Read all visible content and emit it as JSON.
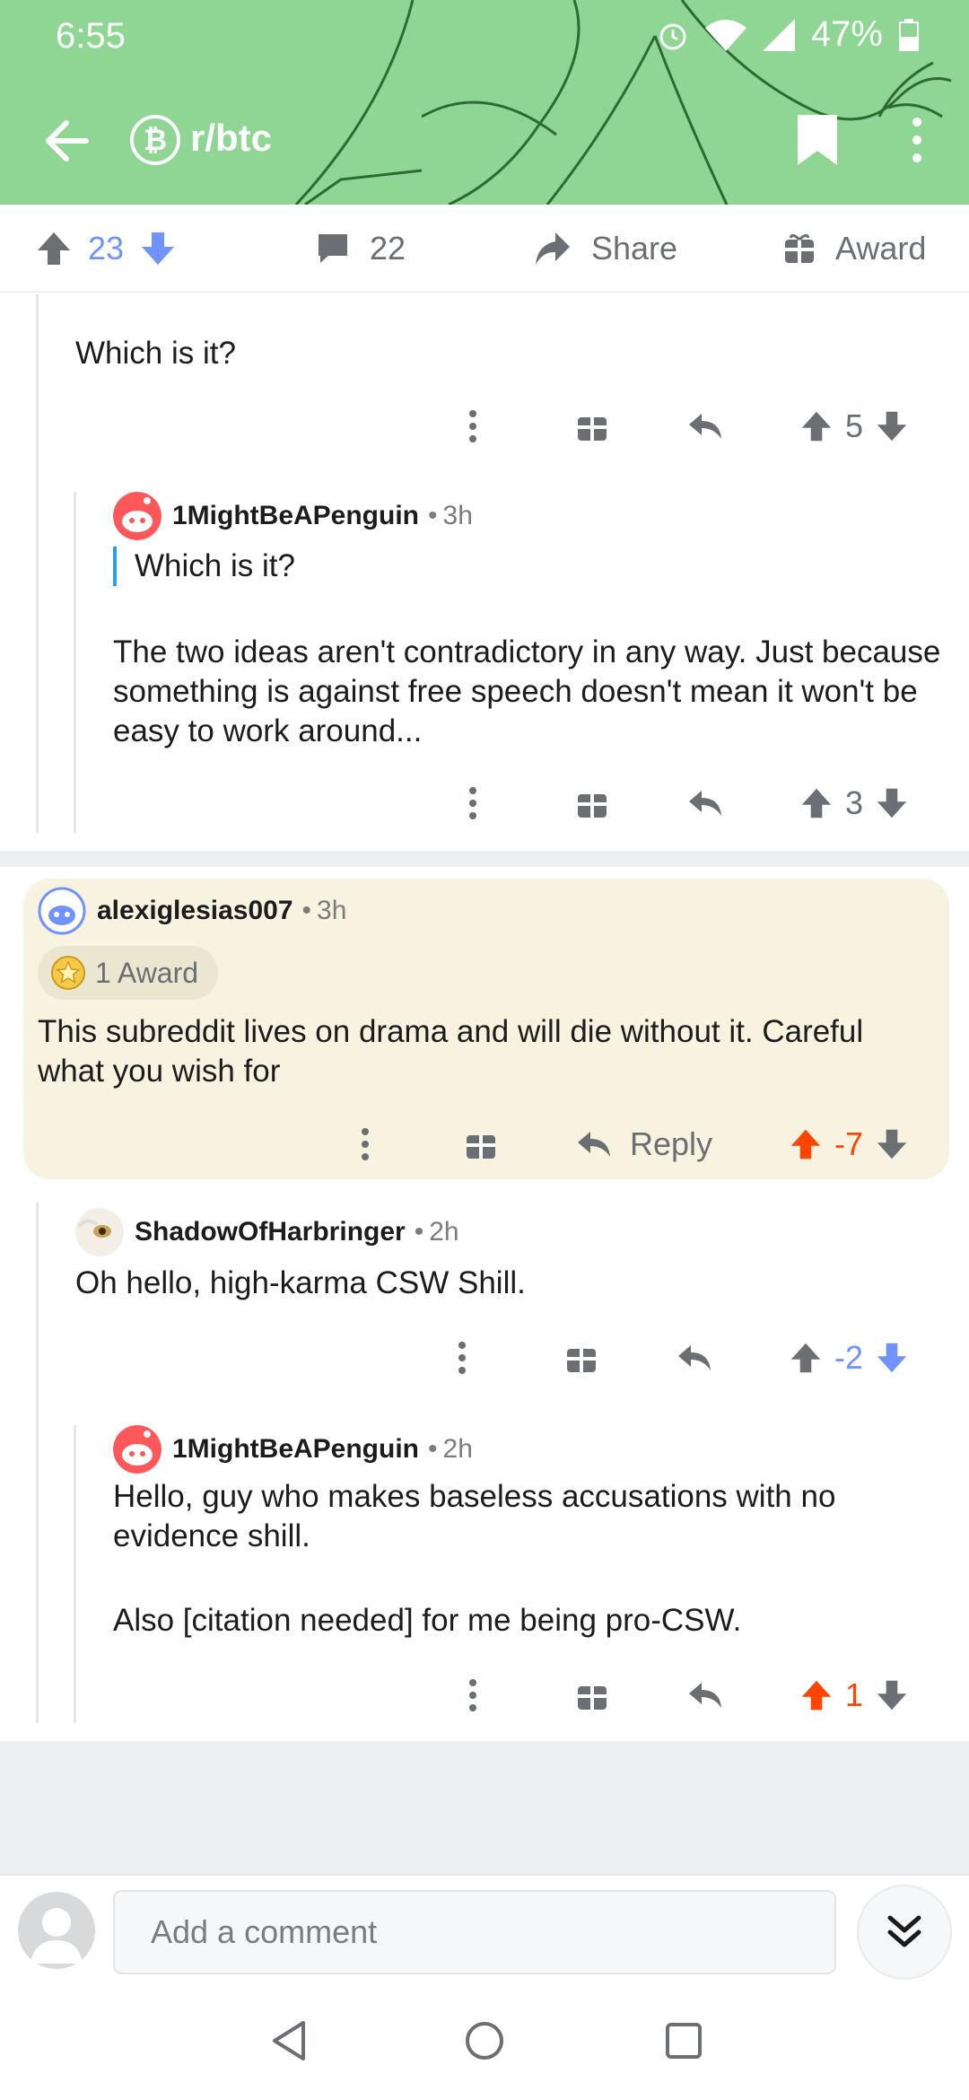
{
  "status_bar": {
    "time": "6:55",
    "battery": "47%"
  },
  "header": {
    "subreddit": "r/btc",
    "subreddit_icon": "bitcoin-icon",
    "colors": {
      "banner": "#8fd694",
      "banner_lines": "#2e6b33"
    }
  },
  "post_actions": {
    "score": "23",
    "comments": "22",
    "share_label": "Share",
    "award_label": "Award"
  },
  "comments": [
    {
      "id": "c1",
      "text": "Which is it?",
      "score": "5"
    },
    {
      "id": "c2",
      "author": "1MightBeAPenguin",
      "time": "3h",
      "quote": "Which is it?",
      "text": "The two ideas aren't contradictory in any way. Just because something is against free speech doesn't mean it won't be easy to work around...",
      "score": "3"
    },
    {
      "id": "c3",
      "author": "alexiglesias007",
      "time": "3h",
      "award": "1 Award",
      "text": "This subreddit lives on drama and will die without it. Careful what you wish for",
      "reply_label": "Reply",
      "score": "-7",
      "vote": "upvoted"
    },
    {
      "id": "c4",
      "author": "ShadowOfHarbringer",
      "time": "2h",
      "text": "Oh hello, high-karma CSW Shill.",
      "score": "-2",
      "vote": "downvoted"
    },
    {
      "id": "c5",
      "author": "1MightBeAPenguin",
      "time": "2h",
      "text_1": "Hello, guy who makes baseless accusations with no evidence shill.",
      "text_2": "Also [citation needed] for me being pro-CSW.",
      "score": "1",
      "vote": "upvoted"
    }
  ],
  "comment_bar": {
    "placeholder": "Add a comment"
  },
  "colors": {
    "upvote": "#ff4500",
    "downvote": "#7193ff",
    "highlight": "#f7f3e0"
  }
}
